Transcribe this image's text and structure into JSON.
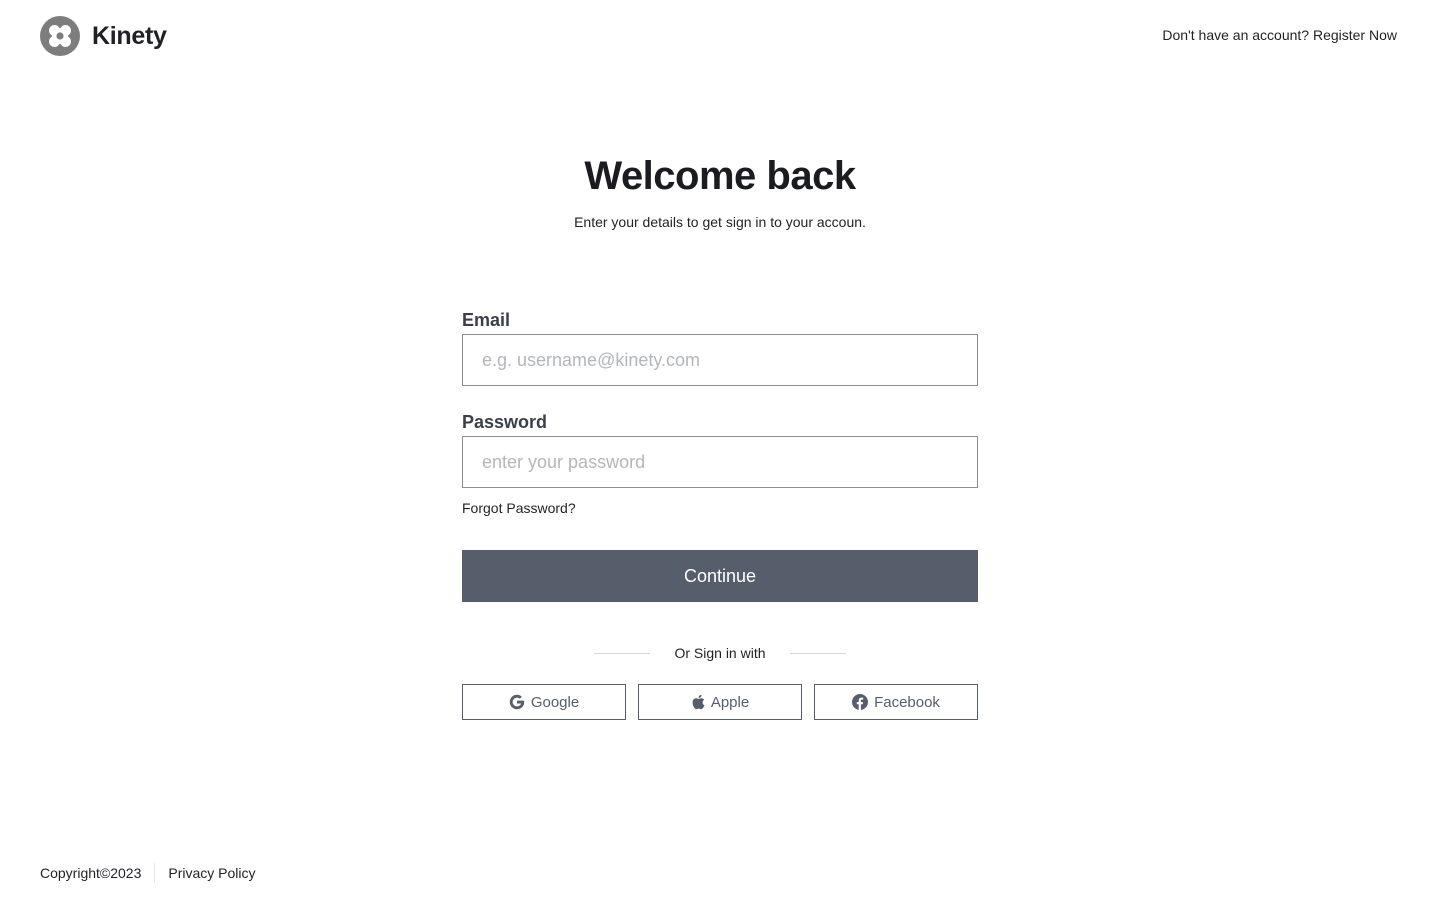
{
  "brand": {
    "name": "Kinety",
    "logo_icon": "flower-logo-icon",
    "logo_color": "#7d7d7d"
  },
  "header": {
    "register_prompt": "Don't have an account? Register Now"
  },
  "main": {
    "title": "Welcome back",
    "subtitle": "Enter your details to get sign in to your accoun."
  },
  "form": {
    "email": {
      "label": "Email",
      "value": "",
      "placeholder": "e.g. username@kinety.com"
    },
    "password": {
      "label": "Password",
      "value": "",
      "placeholder": "enter your password"
    },
    "forgot_password": "Forgot Password?",
    "continue_label": "Continue",
    "button_color": "#565e6c"
  },
  "social": {
    "divider_text": "Or Sign in with",
    "providers": [
      {
        "label": "Google",
        "icon": "google-icon"
      },
      {
        "label": "Apple",
        "icon": "apple-icon"
      },
      {
        "label": "Facebook",
        "icon": "facebook-icon"
      }
    ]
  },
  "footer": {
    "copyright": "Copyright©2023",
    "privacy": "Privacy Policy"
  }
}
